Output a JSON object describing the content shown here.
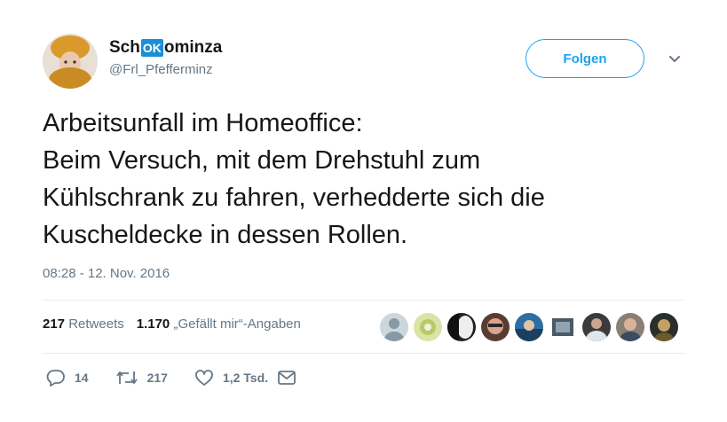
{
  "tweet": {
    "display_name_prefix": "Sch",
    "display_name_badge": "OK",
    "display_name_suffix": "ominza",
    "handle": "@Frl_Pfefferminz",
    "follow_label": "Folgen",
    "text_lines": [
      "Arbeitsunfall im Homeoffice:",
      "Beim Versuch, mit dem Drehstuhl zum",
      "Kühlschrank zu fahren, verhedderte sich die",
      "Kuscheldecke in dessen Rollen."
    ],
    "timestamp": "08:28 - 12. Nov. 2016",
    "stats": {
      "retweets_count": "217",
      "retweets_label": "Retweets",
      "likes_count": "1.170",
      "likes_label": "„Gefällt mir“-Angaben"
    },
    "actions": {
      "reply_count": "14",
      "retweet_count": "217",
      "like_count": "1,2 Tsd."
    }
  },
  "colors": {
    "accent": "#1da1f2",
    "badge": "#1d8fd6",
    "muted": "#657786",
    "text": "#14171a"
  },
  "icons": [
    "reply-icon",
    "retweet-icon",
    "heart-icon",
    "mail-icon",
    "chevron-down-icon"
  ]
}
